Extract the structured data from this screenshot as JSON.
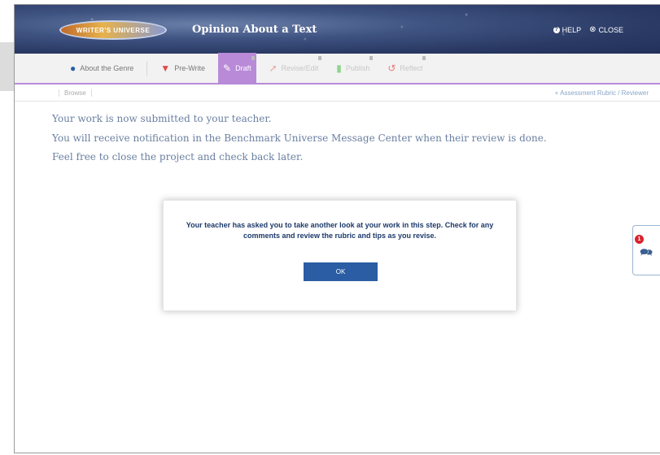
{
  "header": {
    "logo_text": "WRITER'S UNIVERSE",
    "title": "Opinion About a Text",
    "help_label": "HELP",
    "close_label": "CLOSE"
  },
  "tabs": [
    {
      "label": "About the Genre",
      "icon": "info-icon",
      "color": "#2a5da3"
    },
    {
      "label": "Pre-Write",
      "icon": "lightbulb-icon",
      "color": "#e04a4a"
    },
    {
      "label": "Draft",
      "icon": "pencil-icon",
      "color": "#ffffff"
    },
    {
      "label": "Revise/Edit",
      "icon": "cursor-icon",
      "color": "#e07a7a"
    },
    {
      "label": "Publish",
      "icon": "document-icon",
      "color": "#6bc06b"
    },
    {
      "label": "Reflect",
      "icon": "undo-icon",
      "color": "#e04a4a"
    }
  ],
  "subbar": {
    "breadcrumb": "Browse",
    "link": "+ Assessment Rubric / Reviewer"
  },
  "messages": [
    "Your work is now submitted to your teacher.",
    "You will receive notification in the Benchmark Universe Message Center when their review is done.",
    "Feel free to close the project and check back later."
  ],
  "dialog": {
    "text": "Your teacher has asked you to take another look at your work in this step. Check for any comments and review the rubric and tips as you revise.",
    "ok_label": "OK"
  },
  "comments": {
    "badge_count": "1"
  },
  "colors": {
    "accent": "#b88ad8",
    "primary_button": "#2a5da3",
    "message_text": "#6a7fa0",
    "badge": "#d9232d"
  }
}
